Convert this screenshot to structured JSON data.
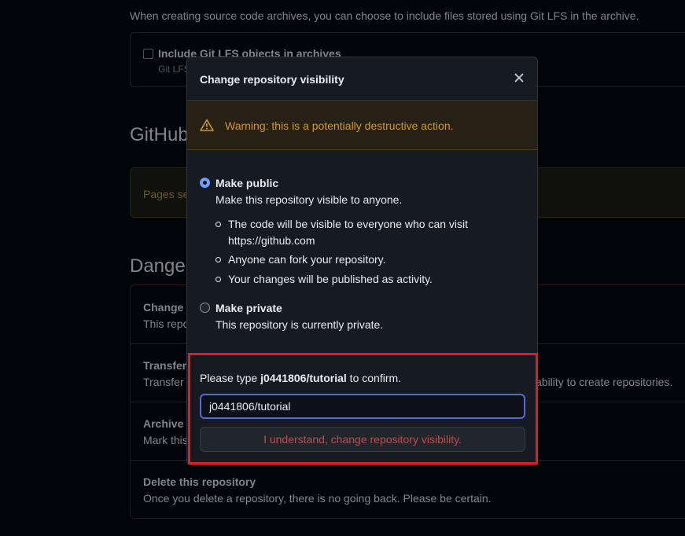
{
  "background": {
    "intro": "When creating source code archives, you can choose to include files stored using Git LFS in the archive.",
    "lfs_checkbox_label": "Include Git LFS objects in archives",
    "lfs_checkbox_desc": "Git LFS",
    "pages_heading": "GitHub",
    "pages_notice": "Pages set",
    "danger_heading": "Danger",
    "danger_rows": [
      {
        "title": "Change r",
        "desc": "This repo"
      },
      {
        "title": "Transfer",
        "desc": "Transfer t",
        "desc_tail": "ability to create repositories."
      },
      {
        "title": "Archive t",
        "desc": "Mark this"
      },
      {
        "title": "Delete this repository",
        "desc": "Once you delete a repository, there is no going back. Please be certain."
      }
    ]
  },
  "modal": {
    "title": "Change repository visibility",
    "warning": "Warning: this is a potentially destructive action.",
    "options": {
      "public": {
        "title": "Make public",
        "desc": "Make this repository visible to anyone.",
        "checked": true,
        "bullets": [
          "The code will be visible to everyone who can visit https://github.com",
          "Anyone can fork your repository.",
          "Your changes will be published as activity."
        ]
      },
      "private": {
        "title": "Make private",
        "desc": "This repository is currently private.",
        "checked": false
      }
    },
    "confirm": {
      "prefix": "Please type ",
      "repo": "j0441806/tutorial",
      "suffix": " to confirm.",
      "input_value": "j0441806/tutorial",
      "button_label": "I understand, change repository visibility."
    }
  },
  "colors": {
    "accent_radio": "#6e9fff",
    "warning": "#d29922",
    "danger_text": "#c54a4a",
    "highlight_frame": "#e01c25"
  }
}
